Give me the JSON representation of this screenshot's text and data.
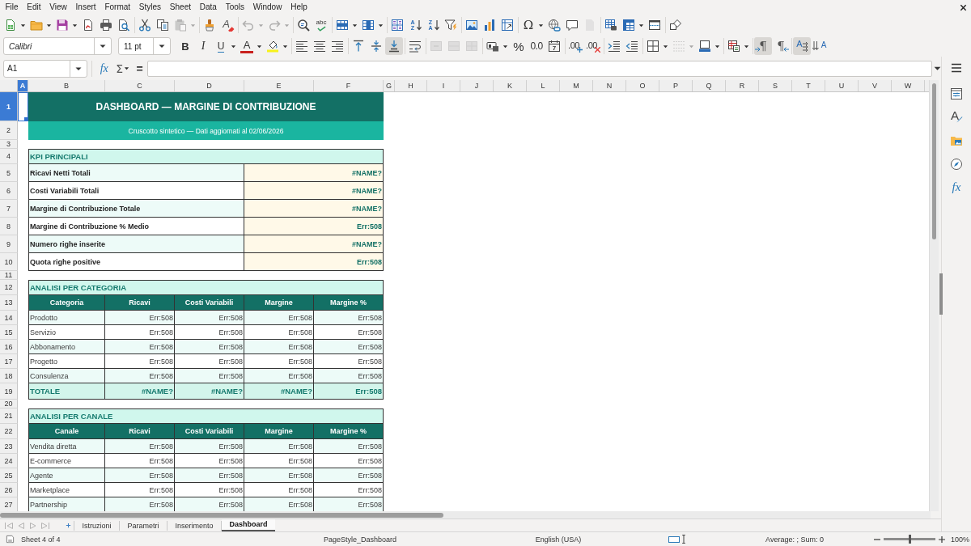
{
  "menu_bar": {
    "items": [
      "File",
      "Edit",
      "View",
      "Insert",
      "Format",
      "Styles",
      "Sheet",
      "Data",
      "Tools",
      "Window",
      "Help"
    ]
  },
  "standard_toolbar": [
    [
      {
        "kind": "new",
        "dropdown": true,
        "disabled": false
      },
      {
        "kind": "open",
        "dropdown": true,
        "disabled": false
      },
      {
        "kind": "save",
        "dropdown": true,
        "disabled": false
      },
      {
        "kind": "pdf",
        "disabled": false
      },
      {
        "kind": "print",
        "disabled": false
      },
      {
        "kind": "preview",
        "disabled": false
      }
    ],
    [
      {
        "kind": "cut",
        "disabled": false
      },
      {
        "kind": "copy",
        "disabled": false
      },
      {
        "kind": "paste",
        "dropdown": true,
        "disabled": true
      }
    ],
    [
      {
        "kind": "clone",
        "disabled": false
      },
      {
        "kind": "clear",
        "glyph": "A",
        "disabled": false
      }
    ],
    [
      {
        "kind": "undo",
        "dropdown": true,
        "disabled": true
      },
      {
        "kind": "redo",
        "dropdown": true,
        "disabled": true
      }
    ],
    [
      {
        "kind": "find",
        "disabled": false
      },
      {
        "kind": "spelling",
        "glyph": "abc",
        "disabled": false
      }
    ],
    [
      {
        "kind": "rows",
        "dropdown": true,
        "disabled": false
      },
      {
        "kind": "columns",
        "dropdown": true,
        "disabled": false
      }
    ],
    [
      {
        "kind": "sort",
        "disabled": false
      },
      {
        "kind": "ascending",
        "glyph": "AZ",
        "disabled": false
      },
      {
        "kind": "descending",
        "glyph": "ZA",
        "disabled": false
      },
      {
        "kind": "filter",
        "disabled": false
      }
    ],
    [
      {
        "kind": "image",
        "disabled": false
      },
      {
        "kind": "chart",
        "disabled": false
      },
      {
        "kind": "pivot",
        "disabled": false
      }
    ],
    [
      {
        "kind": "symbol",
        "glyph": "Ω",
        "dropdown": true,
        "disabled": false
      },
      {
        "kind": "hyperlink",
        "disabled": false
      },
      {
        "kind": "comment",
        "disabled": false
      },
      {
        "kind": "headers",
        "disabled": true
      }
    ],
    [
      {
        "kind": "printarea",
        "disabled": false
      },
      {
        "kind": "freeze",
        "dropdown": true,
        "disabled": false
      },
      {
        "kind": "split",
        "disabled": false
      }
    ],
    [
      {
        "kind": "shapes",
        "disabled": false
      }
    ]
  ],
  "formatting_toolbar": {
    "font_name": "Calibri",
    "font_size": "11 pt",
    "groups": [
      [
        {
          "kind": "bold",
          "glyph": "B",
          "on": false,
          "disabled": false
        },
        {
          "kind": "italic",
          "glyph": "I",
          "on": false,
          "disabled": false
        },
        {
          "kind": "underline",
          "glyph": "U",
          "dropdown": true,
          "on": false,
          "disabled": false
        },
        {
          "kind": "fontcolor",
          "glyph": "A",
          "dropdown": true,
          "on": false,
          "disabled": false
        },
        {
          "kind": "highlight",
          "dropdown": true,
          "on": false,
          "disabled": false
        }
      ],
      [
        {
          "kind": "left",
          "on": false,
          "disabled": false
        },
        {
          "kind": "center",
          "on": false,
          "disabled": false
        },
        {
          "kind": "right",
          "on": false,
          "disabled": false
        }
      ],
      [
        {
          "kind": "top",
          "on": false,
          "disabled": false
        },
        {
          "kind": "middle",
          "on": false,
          "disabled": false
        },
        {
          "kind": "bottom",
          "on": true,
          "disabled": false
        }
      ],
      [
        {
          "kind": "wrap",
          "on": false,
          "disabled": false
        }
      ],
      [
        {
          "kind": "mergecenter",
          "on": false,
          "disabled": true
        },
        {
          "kind": "merge",
          "on": false,
          "disabled": true
        },
        {
          "kind": "unmerge",
          "on": false,
          "disabled": true
        }
      ],
      [
        {
          "kind": "currency",
          "dropdown": true,
          "on": false,
          "disabled": false
        },
        {
          "kind": "percent",
          "glyph": "%",
          "on": false,
          "disabled": false
        },
        {
          "kind": "number",
          "glyph": "0.0",
          "on": false,
          "disabled": false
        },
        {
          "kind": "date",
          "glyph": "7",
          "on": false,
          "disabled": false
        }
      ],
      [
        {
          "kind": "adddecimal",
          "glyph": ".00",
          "on": false,
          "disabled": false
        },
        {
          "kind": "deldecimal",
          "glyph": ".00",
          "on": false,
          "disabled": false
        }
      ],
      [
        {
          "kind": "indent",
          "on": false,
          "disabled": false
        },
        {
          "kind": "outdent",
          "on": false,
          "disabled": false
        }
      ],
      [
        {
          "kind": "borders",
          "dropdown": true,
          "on": false,
          "disabled": false
        },
        {
          "kind": "linestyle",
          "dropdown": true,
          "on": false,
          "disabled": true
        },
        {
          "kind": "linecolor",
          "dropdown": true,
          "on": false,
          "disabled": false
        }
      ],
      [
        {
          "kind": "conditional",
          "dropdown": true,
          "on": false,
          "disabled": false
        }
      ],
      [
        {
          "kind": "ltr",
          "glyph": "¶",
          "on": true,
          "disabled": false
        },
        {
          "kind": "rtl",
          "glyph": "¶",
          "on": false,
          "disabled": false
        }
      ],
      [
        {
          "kind": "horizontal",
          "glyph": "A",
          "on": true,
          "disabled": false
        },
        {
          "kind": "vertical",
          "glyph": "A",
          "on": false,
          "disabled": false
        }
      ]
    ]
  },
  "formula_bar": {
    "name_box": "A1",
    "function_wizard": "fx",
    "sum": "Σ",
    "equals": "="
  },
  "sidebar": [
    {
      "kind": "menu"
    },
    {
      "kind": "properties"
    },
    {
      "kind": "styles",
      "glyph": "A"
    },
    {
      "kind": "gallery"
    },
    {
      "kind": "navigator"
    },
    {
      "kind": "functions",
      "glyph": "fx"
    }
  ],
  "sheet": {
    "columns": [
      {
        "label": "A",
        "selected": true
      },
      {
        "label": "B",
        "selected": false
      },
      {
        "label": "C",
        "selected": false
      },
      {
        "label": "D",
        "selected": false
      },
      {
        "label": "E",
        "selected": false
      },
      {
        "label": "F",
        "selected": false
      },
      {
        "label": "G",
        "selected": false
      },
      {
        "label": "H",
        "selected": false
      },
      {
        "label": "I",
        "selected": false
      },
      {
        "label": "J",
        "selected": false
      },
      {
        "label": "K",
        "selected": false
      },
      {
        "label": "L",
        "selected": false
      },
      {
        "label": "M",
        "selected": false
      },
      {
        "label": "N",
        "selected": false
      },
      {
        "label": "O",
        "selected": false
      },
      {
        "label": "P",
        "selected": false
      },
      {
        "label": "Q",
        "selected": false
      },
      {
        "label": "R",
        "selected": false
      },
      {
        "label": "S",
        "selected": false
      },
      {
        "label": "T",
        "selected": false
      },
      {
        "label": "U",
        "selected": false
      },
      {
        "label": "V",
        "selected": false
      },
      {
        "label": "W",
        "selected": false
      }
    ],
    "rows": [
      {
        "number": "1",
        "selected": true,
        "kind": "title",
        "text": "DASHBOARD — MARGINE DI CONTRIBUZIONE"
      },
      {
        "number": "2",
        "selected": false,
        "kind": "subtitle",
        "text": "Cruscotto sintetico — Dati aggiornati al 02/06/2026"
      },
      {
        "number": "3",
        "selected": false,
        "kind": "blank"
      },
      {
        "number": "4",
        "selected": false,
        "kind": "section",
        "text": "KPI PRINCIPALI"
      },
      {
        "number": "5",
        "selected": false,
        "kind": "kpi",
        "label": "Ricavi Netti Totali",
        "value": "#NAME?"
      },
      {
        "number": "6",
        "selected": false,
        "kind": "kpi",
        "label": "Costi Variabili Totali",
        "value": "#NAME?"
      },
      {
        "number": "7",
        "selected": false,
        "kind": "kpi",
        "label": "Margine di Contribuzione Totale",
        "value": "#NAME?"
      },
      {
        "number": "8",
        "selected": false,
        "kind": "kpi",
        "label": "Margine di Contribuzione % Medio",
        "value": "Err:508"
      },
      {
        "number": "9",
        "selected": false,
        "kind": "kpi",
        "label": "Numero righe inserite",
        "value": "#NAME?"
      },
      {
        "number": "10",
        "selected": false,
        "kind": "kpi",
        "label": "Quota righe positive",
        "value": "Err:508"
      },
      {
        "number": "11",
        "selected": false,
        "kind": "blank"
      },
      {
        "number": "12",
        "selected": false,
        "kind": "section",
        "text": "ANALISI PER CATEGORIA"
      },
      {
        "number": "13",
        "selected": false,
        "kind": "header",
        "cells": [
          "Categoria",
          "Ricavi",
          "Costi Variabili",
          "Margine",
          "Margine %"
        ]
      },
      {
        "number": "14",
        "selected": false,
        "kind": "data",
        "cells": [
          "Prodotto",
          "Err:508",
          "Err:508",
          "Err:508",
          "Err:508"
        ]
      },
      {
        "number": "15",
        "selected": false,
        "kind": "data",
        "cells": [
          "Servizio",
          "Err:508",
          "Err:508",
          "Err:508",
          "Err:508"
        ]
      },
      {
        "number": "16",
        "selected": false,
        "kind": "data",
        "cells": [
          "Abbonamento",
          "Err:508",
          "Err:508",
          "Err:508",
          "Err:508"
        ]
      },
      {
        "number": "17",
        "selected": false,
        "kind": "data",
        "cells": [
          "Progetto",
          "Err:508",
          "Err:508",
          "Err:508",
          "Err:508"
        ]
      },
      {
        "number": "18",
        "selected": false,
        "kind": "data",
        "cells": [
          "Consulenza",
          "Err:508",
          "Err:508",
          "Err:508",
          "Err:508"
        ]
      },
      {
        "number": "19",
        "selected": false,
        "kind": "total",
        "cells": [
          "TOTALE",
          "#NAME?",
          "#NAME?",
          "#NAME?",
          "Err:508"
        ]
      },
      {
        "number": "20",
        "selected": false,
        "kind": "blank"
      },
      {
        "number": "21",
        "selected": false,
        "kind": "section",
        "text": "ANALISI PER CANALE"
      },
      {
        "number": "22",
        "selected": false,
        "kind": "header",
        "cells": [
          "Canale",
          "Ricavi",
          "Costi Variabili",
          "Margine",
          "Margine %"
        ]
      },
      {
        "number": "23",
        "selected": false,
        "kind": "data",
        "cells": [
          "Vendita diretta",
          "Err:508",
          "Err:508",
          "Err:508",
          "Err:508"
        ]
      },
      {
        "number": "24",
        "selected": false,
        "kind": "data",
        "cells": [
          "E-commerce",
          "Err:508",
          "Err:508",
          "Err:508",
          "Err:508"
        ]
      },
      {
        "number": "25",
        "selected": false,
        "kind": "data",
        "cells": [
          "Agente",
          "Err:508",
          "Err:508",
          "Err:508",
          "Err:508"
        ]
      },
      {
        "number": "26",
        "selected": false,
        "kind": "data",
        "cells": [
          "Marketplace",
          "Err:508",
          "Err:508",
          "Err:508",
          "Err:508"
        ]
      },
      {
        "number": "27",
        "selected": false,
        "kind": "data",
        "cells": [
          "Partnership",
          "Err:508",
          "Err:508",
          "Err:508",
          "Err:508"
        ]
      }
    ]
  },
  "sheet_tab_bar": {
    "navigation_disabled": true,
    "tabs": [
      {
        "label": "Istruzioni",
        "selected": false
      },
      {
        "label": "Parametri",
        "selected": false
      },
      {
        "label": "Inserimento",
        "selected": false
      },
      {
        "label": "Dashboard",
        "selected": true
      }
    ]
  },
  "status_bar": {
    "sheet": "Sheet 4 of 4",
    "page_style": "PageStyle_Dashboard",
    "language": "English (USA)",
    "summary": "Average: ; Sum: 0",
    "zoom": {
      "level": 0.5,
      "reading": "100%"
    }
  }
}
